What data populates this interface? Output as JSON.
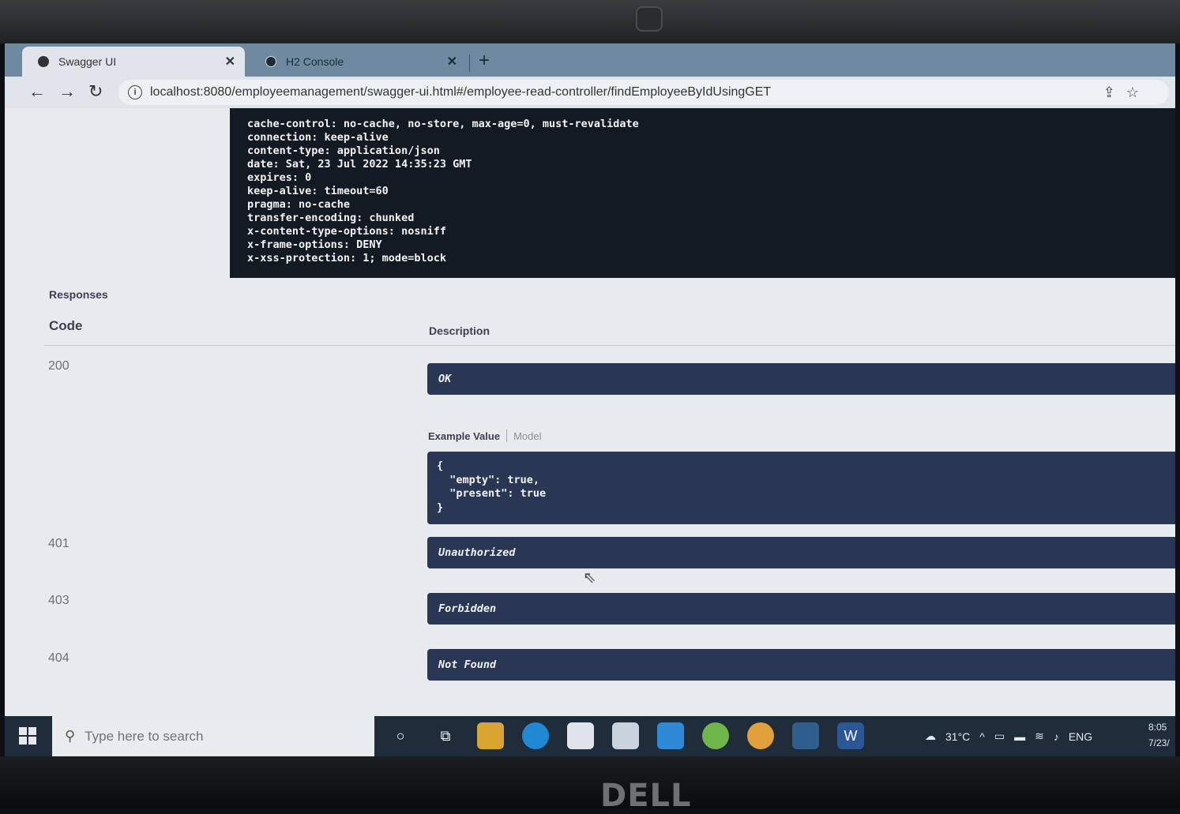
{
  "browser": {
    "tabs": [
      {
        "label": "Swagger UI",
        "active": true
      },
      {
        "label": "H2 Console",
        "active": false
      }
    ],
    "url": "localhost:8080/employeemanagement/swagger-ui.html#/employee-read-controller/findEmployeeByIdUsingGET"
  },
  "response_headers": [
    "cache-control: no-cache, no-store, max-age=0, must-revalidate",
    "connection: keep-alive",
    "content-type: application/json",
    "date: Sat, 23 Jul 2022 14:35:23 GMT",
    "expires: 0",
    "keep-alive: timeout=60",
    "pragma: no-cache",
    "transfer-encoding: chunked",
    "x-content-type-options: nosniff",
    "x-frame-options: DENY",
    "x-xss-protection: 1; mode=block"
  ],
  "responses": {
    "title": "Responses",
    "col_code": "Code",
    "col_description": "Description",
    "rows": [
      {
        "code": "200",
        "description": "OK"
      },
      {
        "code": "401",
        "description": "Unauthorized"
      },
      {
        "code": "403",
        "description": "Forbidden"
      },
      {
        "code": "404",
        "description": "Not Found"
      }
    ],
    "example_tabs": {
      "example_value": "Example Value",
      "model": "Model"
    },
    "example_lines": [
      "{",
      "  \"empty\": true,",
      "  \"present\": true",
      "}"
    ]
  },
  "taskbar": {
    "search_placeholder": "Type here to search",
    "weather": "31°C",
    "language": "ENG",
    "time": "8:05",
    "date": "7/23/"
  },
  "device": {
    "brand": "DELL"
  }
}
